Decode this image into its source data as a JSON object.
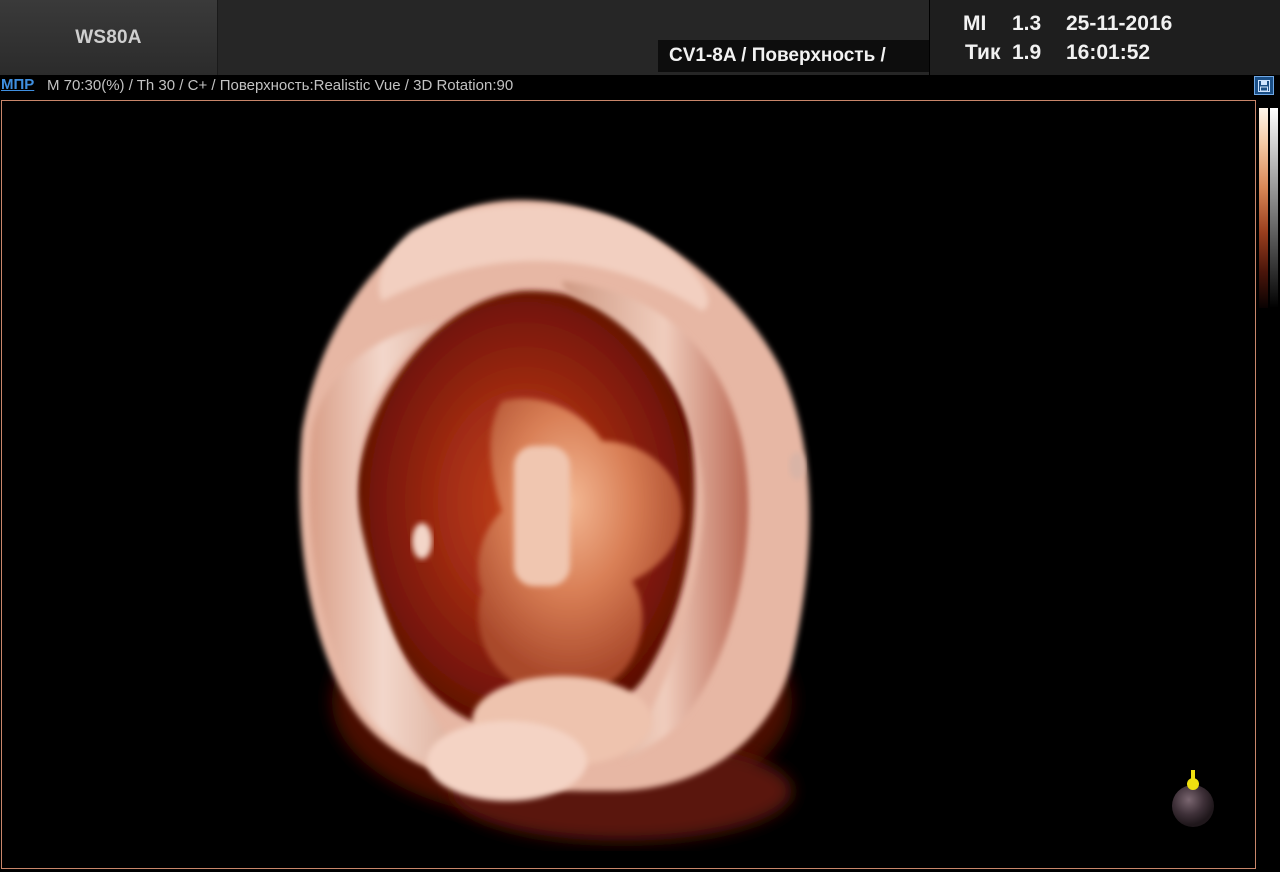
{
  "header": {
    "device": "WS80A",
    "probe_mode": "CV1-8A / Поверхность /",
    "mi_label": "MI",
    "mi_value": "1.3",
    "tik_label": "Тик",
    "tik_value": "1.9",
    "date": "25-11-2016",
    "time": "16:01:52"
  },
  "infobar": {
    "tab": "МПР",
    "params": "M 70:30(%) / Th 30 / C+ / Поверхность:Realistic Vue / 3D Rotation:90"
  },
  "icons": {
    "save": "save-icon",
    "orientation": "orientation-marker-icon",
    "colormap": "colormap-bar"
  },
  "colors": {
    "frame_border": "#c9866a",
    "tab_link": "#3f8fe0",
    "marker_yellow": "#f0e010"
  }
}
